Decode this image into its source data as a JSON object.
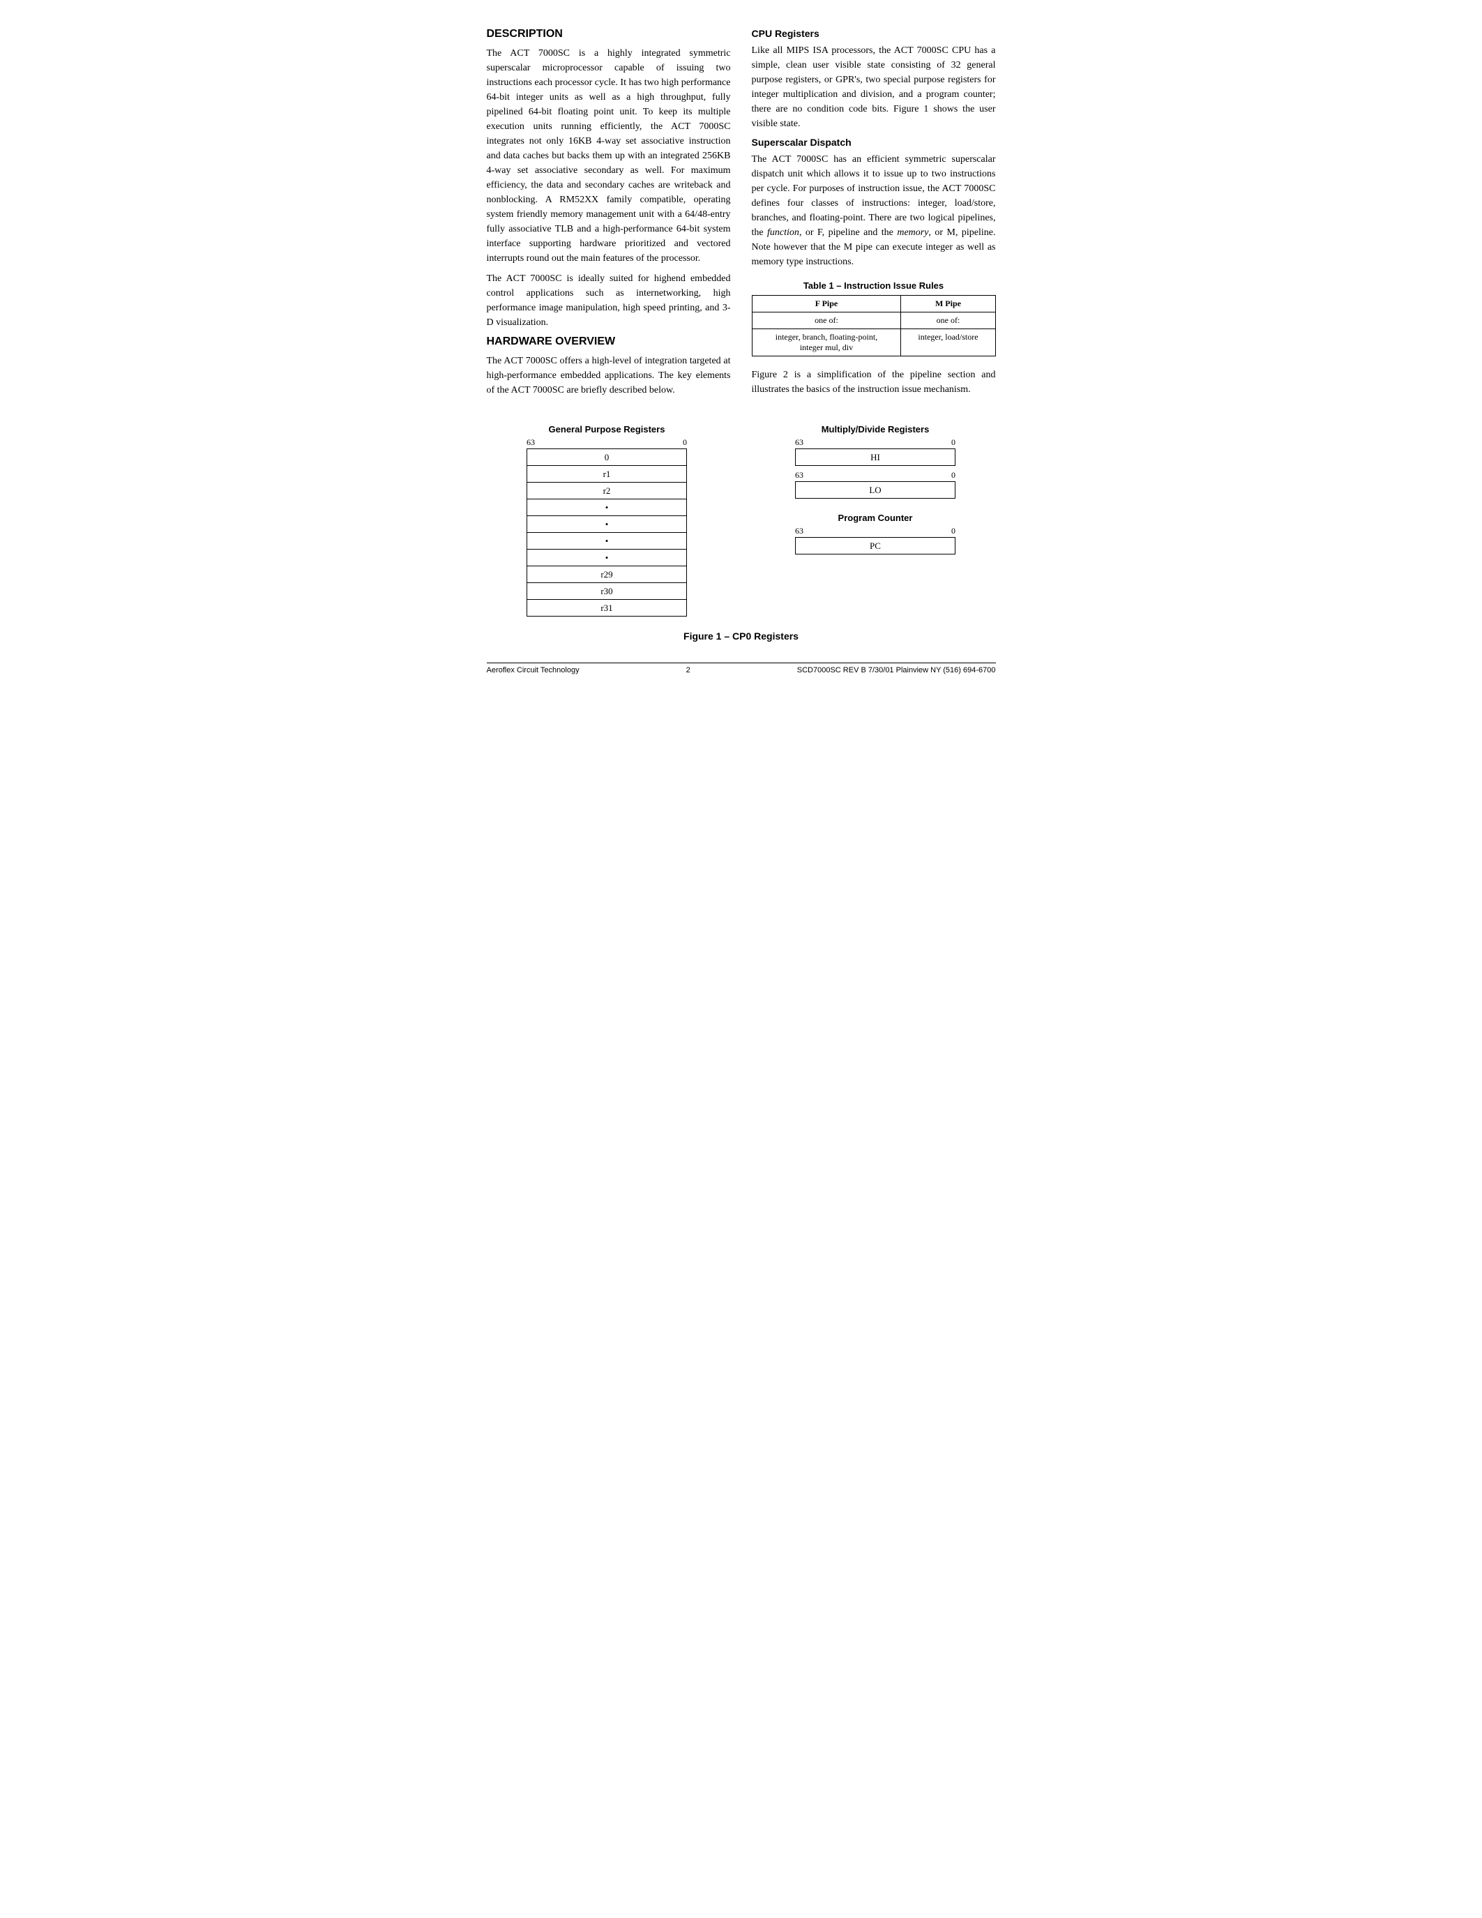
{
  "sections": {
    "description": {
      "title": "Description",
      "paragraphs": [
        "The ACT 7000SC is a highly integrated symmetric superscalar microprocessor capable of issuing two instructions each processor cycle. It has two high performance 64-bit integer units as well as a high throughput, fully pipelined 64-bit floating point unit. To keep its multiple execution units running efficiently, the ACT 7000SC integrates not only 16KB 4-way set associative instruction and data caches but backs them up with an integrated 256KB 4-way set associative secondary as well. For maximum efficiency, the data and secondary caches are writeback and nonblocking. A RM52XX family compatible, operating system friendly memory management unit with a 64/48-entry fully associative TLB and a high-performance 64-bit system interface supporting hardware prioritized and vectored interrupts round out the main features of the processor.",
        "The ACT 7000SC is ideally suited for highend embedded control applications such as internetworking, high performance image manipulation, high speed printing, and 3-D visualization."
      ]
    },
    "hardware_overview": {
      "title": "Hardware Overview",
      "paragraphs": [
        "The ACT 7000SC offers a high-level of integration targeted at high-performance embedded applications. The key elements of the ACT 7000SC are briefly described below."
      ]
    },
    "cpu_registers": {
      "title": "CPU Registers",
      "paragraphs": [
        "Like all MIPS ISA processors, the ACT 7000SC CPU has a simple, clean user visible state consisting of 32 general purpose registers, or GPR's, two special purpose registers for integer multiplication and division, and a program counter; there are no condition code bits. Figure 1 shows the user visible state."
      ]
    },
    "superscalar_dispatch": {
      "title": "Superscalar Dispatch",
      "paragraphs": [
        "The ACT 7000SC has an efficient symmetric superscalar dispatch unit which allows it to issue up to two instructions per cycle. For purposes of instruction issue, the ACT 7000SC defines four classes of instructions: integer, load/store, branches, and floating-point. There are two logical pipelines, the function, or F, pipeline and the memory, or M, pipeline. Note however that the M pipe can execute integer as well as memory type instructions."
      ]
    },
    "table": {
      "title": "Table 1 – Instruction Issue Rules",
      "col_headers": [
        "F Pipe",
        "M Pipe"
      ],
      "row1": [
        "one of:",
        "one of:"
      ],
      "row2": [
        "integer, branch, floating-point,\ninteger mul, div",
        "integer, load/store"
      ]
    },
    "figure_note": "Figure 2 is a simplification of the pipeline section and illustrates the basics of the instruction issue mechanism.",
    "gpr": {
      "title": "General Purpose Registers",
      "bit_left": "63",
      "bit_right": "0",
      "rows": [
        "0",
        "r1",
        "r2",
        "•",
        "•",
        "•",
        "•",
        "r29",
        "r30",
        "r31"
      ]
    },
    "multiply_divide": {
      "title": "Multiply/Divide Registers",
      "bit_left": "63",
      "bit_right": "0",
      "hi_label": "HI",
      "lo_bit_left": "63",
      "lo_bit_right": "0",
      "lo_label": "LO"
    },
    "program_counter": {
      "title": "Program Counter",
      "bit_left": "63",
      "bit_right": "0",
      "pc_label": "PC"
    },
    "figure_caption": "Figure 1 – CP0 Registers",
    "footer": {
      "left": "Aeroflex Circuit Technology",
      "center": "2",
      "right": "SCD7000SC REV B  7/30/01 Plainview NY (516) 694-6700"
    }
  }
}
